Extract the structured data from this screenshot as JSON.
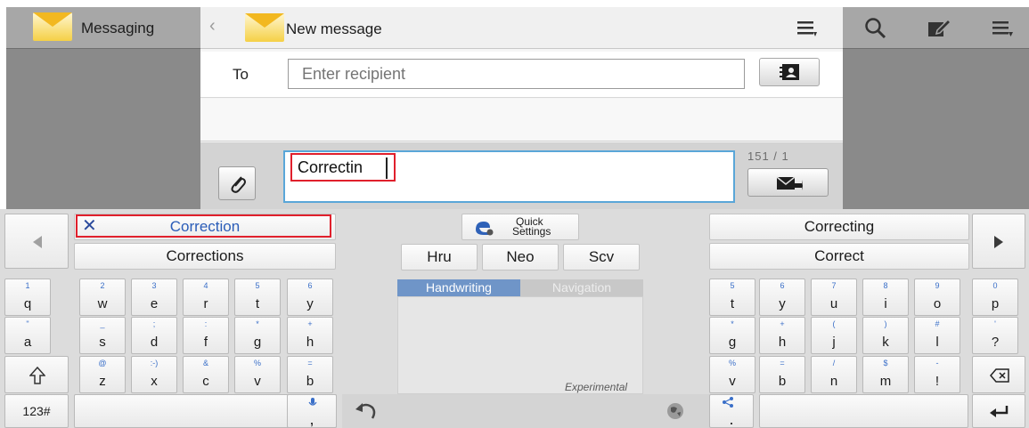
{
  "left_panel": {
    "title": "Messaging",
    "icon": "envelope-icon"
  },
  "header": {
    "back": "‹",
    "title": "New message",
    "menu_icon": "menu-icon"
  },
  "right_panel": {
    "icons": [
      "search-icon",
      "compose-icon",
      "menu-icon"
    ]
  },
  "recipient": {
    "label": "To",
    "placeholder": "Enter recipient",
    "contacts_icon": "contacts-icon"
  },
  "compose": {
    "text": "Correctin",
    "counter": "151 / 1",
    "attach_icon": "paperclip-icon",
    "send_icon": "send-message-icon"
  },
  "keyboard": {
    "suggestions_left": [
      "Correction",
      "Corrections"
    ],
    "suggestions_right": [
      "Correcting",
      "Correct"
    ],
    "center_buttons": [
      "Hru",
      "Neo",
      "Scv"
    ],
    "quick_settings": [
      "Quick",
      "Settings"
    ],
    "hw_tabs": [
      "Handwriting",
      "Navigation"
    ],
    "experimental": "Experimental",
    "left_rows": [
      [
        {
          "h": "1",
          "m": "q"
        },
        {
          "h": "2",
          "m": "w"
        },
        {
          "h": "3",
          "m": "e"
        },
        {
          "h": "4",
          "m": "r"
        },
        {
          "h": "5",
          "m": "t"
        },
        {
          "h": "6",
          "m": "y"
        }
      ],
      [
        {
          "h": "\"",
          "m": "a"
        },
        {
          "h": "_",
          "m": "s"
        },
        {
          "h": ";",
          "m": "d"
        },
        {
          "h": ":",
          "m": "f"
        },
        {
          "h": "*",
          "m": "g"
        },
        {
          "h": "+",
          "m": "h"
        }
      ],
      [
        {
          "h": "@",
          "m": "z"
        },
        {
          "h": ":-)",
          "m": "x"
        },
        {
          "h": "&",
          "m": "c"
        },
        {
          "h": "%",
          "m": "v"
        },
        {
          "h": "=",
          "m": "b"
        }
      ]
    ],
    "right_rows": [
      [
        {
          "h": "5",
          "m": "t"
        },
        {
          "h": "6",
          "m": "y"
        },
        {
          "h": "7",
          "m": "u"
        },
        {
          "h": "8",
          "m": "i"
        },
        {
          "h": "9",
          "m": "o"
        },
        {
          "h": "0",
          "m": "p"
        }
      ],
      [
        {
          "h": "*",
          "m": "g"
        },
        {
          "h": "+",
          "m": "h"
        },
        {
          "h": "(",
          "m": "j"
        },
        {
          "h": ")",
          "m": "k"
        },
        {
          "h": "#",
          "m": "l"
        },
        {
          "h": "'",
          "m": "?"
        }
      ],
      [
        {
          "h": "%",
          "m": "v"
        },
        {
          "h": "=",
          "m": "b"
        },
        {
          "h": "/",
          "m": "n"
        },
        {
          "h": "$",
          "m": "m"
        },
        {
          "h": "-",
          "m": "!"
        }
      ]
    ],
    "numbers_key": "123#",
    "comma_key": ",",
    "period_key": "."
  },
  "colors": {
    "accent_blue": "#5aa6d8",
    "highlight_red": "#e0202c",
    "hw_tab_active": "#6f95c8"
  }
}
